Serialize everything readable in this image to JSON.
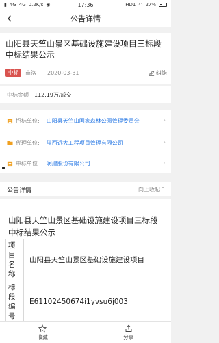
{
  "status": {
    "carrier_left": "4G",
    "carrier_right": "4G",
    "speed": "0.2K/s",
    "time": "17:36",
    "hd": "HD1",
    "battery": "27%"
  },
  "nav": {
    "title": "公告详情"
  },
  "header": {
    "title": "山阳县天竺山景区基础设施建设项目三标段中标结果公示",
    "badge": "中标",
    "region": "商洛",
    "date": "2020-03-31",
    "correct_label": "纠错"
  },
  "amount": {
    "label": "中标金额",
    "value": "112.19万/成交"
  },
  "units": [
    {
      "label": "招标单位:",
      "value": "山阳县天竺山国家森林公园管理委员会",
      "color": "#f0a020"
    },
    {
      "label": "代理单位:",
      "value": "陕西远大工程项目管理有限公司",
      "color": "#f0a020"
    },
    {
      "label": "中标单位:",
      "value": "润建股份有限公司",
      "color": "#f0a020"
    }
  ],
  "section": {
    "title": "公告详情",
    "collapse_label": "向上收起"
  },
  "detail": {
    "title": "山阳县天竺山景区基础设施建设项目三标段中标结果公示",
    "rows": [
      {
        "key": "项目名称",
        "value": "山阳县天竺山景区基础设施建设项目"
      },
      {
        "key": "标段编号",
        "value": "E61102450674i1yvsu6j003"
      }
    ]
  },
  "bottom": {
    "favorite_label": "收藏",
    "share_label": "分享"
  },
  "colors": {
    "accent": "#2c7be5",
    "badge": "#d9534f",
    "icon": "#f0a020"
  }
}
